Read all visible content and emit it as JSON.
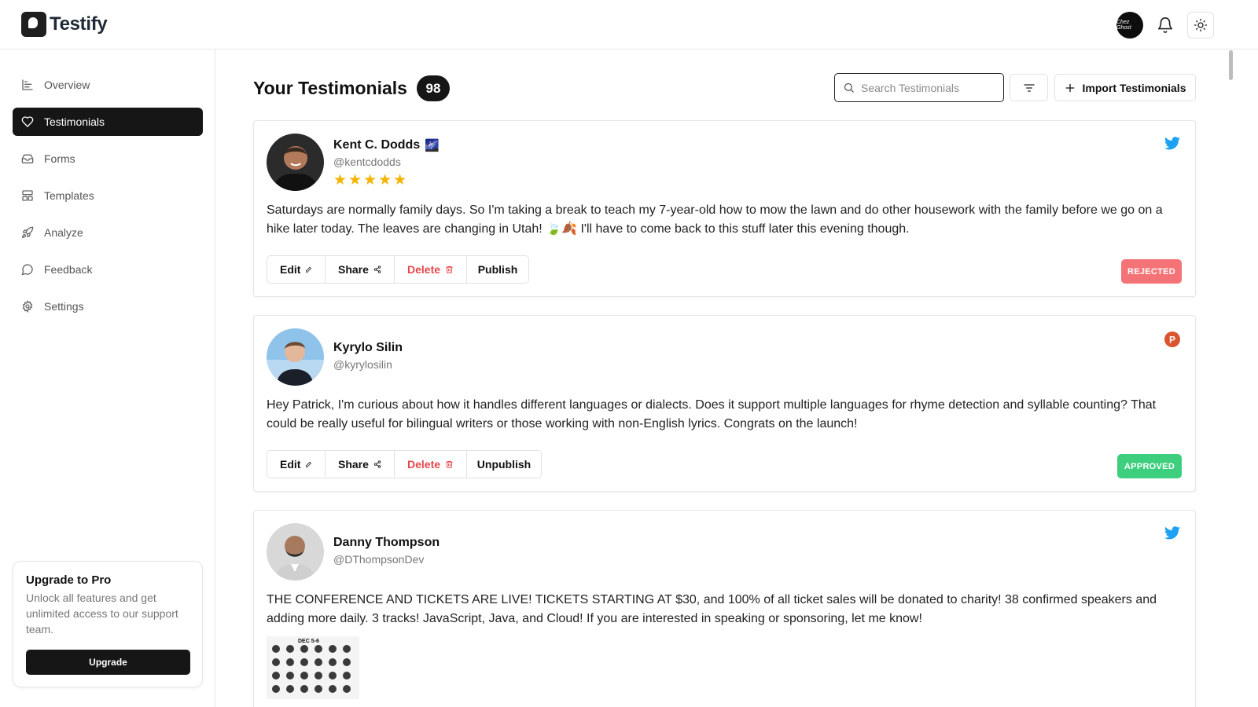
{
  "app": {
    "name": "Testify"
  },
  "colors": {
    "accent": "#161616",
    "rejected": "#f47377",
    "approved": "#3ecf7e",
    "twitter": "#1da1f2",
    "producthunt": "#da552f",
    "star": "#f4b400"
  },
  "header": {
    "avatar_text": "Chez Ghost",
    "icons": [
      "bell-icon",
      "sun-icon"
    ]
  },
  "sidebar": {
    "items": [
      {
        "label": "Overview",
        "icon": "chart-icon",
        "active": false
      },
      {
        "label": "Testimonials",
        "icon": "heart-icon",
        "active": true
      },
      {
        "label": "Forms",
        "icon": "inbox-icon",
        "active": false
      },
      {
        "label": "Templates",
        "icon": "layout-icon",
        "active": false
      },
      {
        "label": "Analyze",
        "icon": "rocket-icon",
        "active": false
      },
      {
        "label": "Feedback",
        "icon": "message-icon",
        "active": false
      },
      {
        "label": "Settings",
        "icon": "gear-icon",
        "active": false
      }
    ],
    "upgrade": {
      "title": "Upgrade to Pro",
      "description": "Unlock all features and get unlimited access to our support team.",
      "button": "Upgrade"
    }
  },
  "main": {
    "title": "Your Testimonials",
    "count": "98",
    "search_placeholder": "Search Testimonials",
    "import_label": "Import Testimonials",
    "testimonials": [
      {
        "name": "Kent C. Dodds",
        "name_emoji": "🌌",
        "handle": "@kentcdodds",
        "stars": "★★★★★",
        "rating": 5,
        "source": "twitter-icon",
        "text": "Saturdays are normally family days. So I'm taking a break to teach my 7-year-old how to mow the lawn and do other housework with the family before we go on a hike later today. The leaves are changing in Utah! 🍃🍂 I'll have to come back to this stuff later this evening though.",
        "actions": {
          "edit": "Edit",
          "share": "Share",
          "delete": "Delete",
          "publish": "Publish"
        },
        "status": "REJECTED"
      },
      {
        "name": "Kyrylo Silin",
        "handle": "@kyrylosilin",
        "source": "producthunt-icon",
        "source_letter": "P",
        "text": "Hey Patrick, I'm curious about how it handles different languages or dialects. Does it support multiple languages for rhyme detection and syllable counting? That could be really useful for bilingual writers or those working with non-English lyrics. Congrats on the launch!",
        "actions": {
          "edit": "Edit",
          "share": "Share",
          "delete": "Delete",
          "publish": "Unpublish"
        },
        "status": "APPROVED"
      },
      {
        "name": "Danny Thompson",
        "handle": "@DThompsonDev",
        "source": "twitter-icon",
        "text": "THE CONFERENCE AND TICKETS ARE LIVE! TICKETS STARTING AT $30, and 100% of all ticket sales will be donated to charity! 38 confirmed speakers and adding more daily. 3 tracks! JavaScript, Java, and Cloud! If you are interested in speaking or sponsoring, let me know!",
        "image_label": "DEC 5-6"
      }
    ]
  }
}
